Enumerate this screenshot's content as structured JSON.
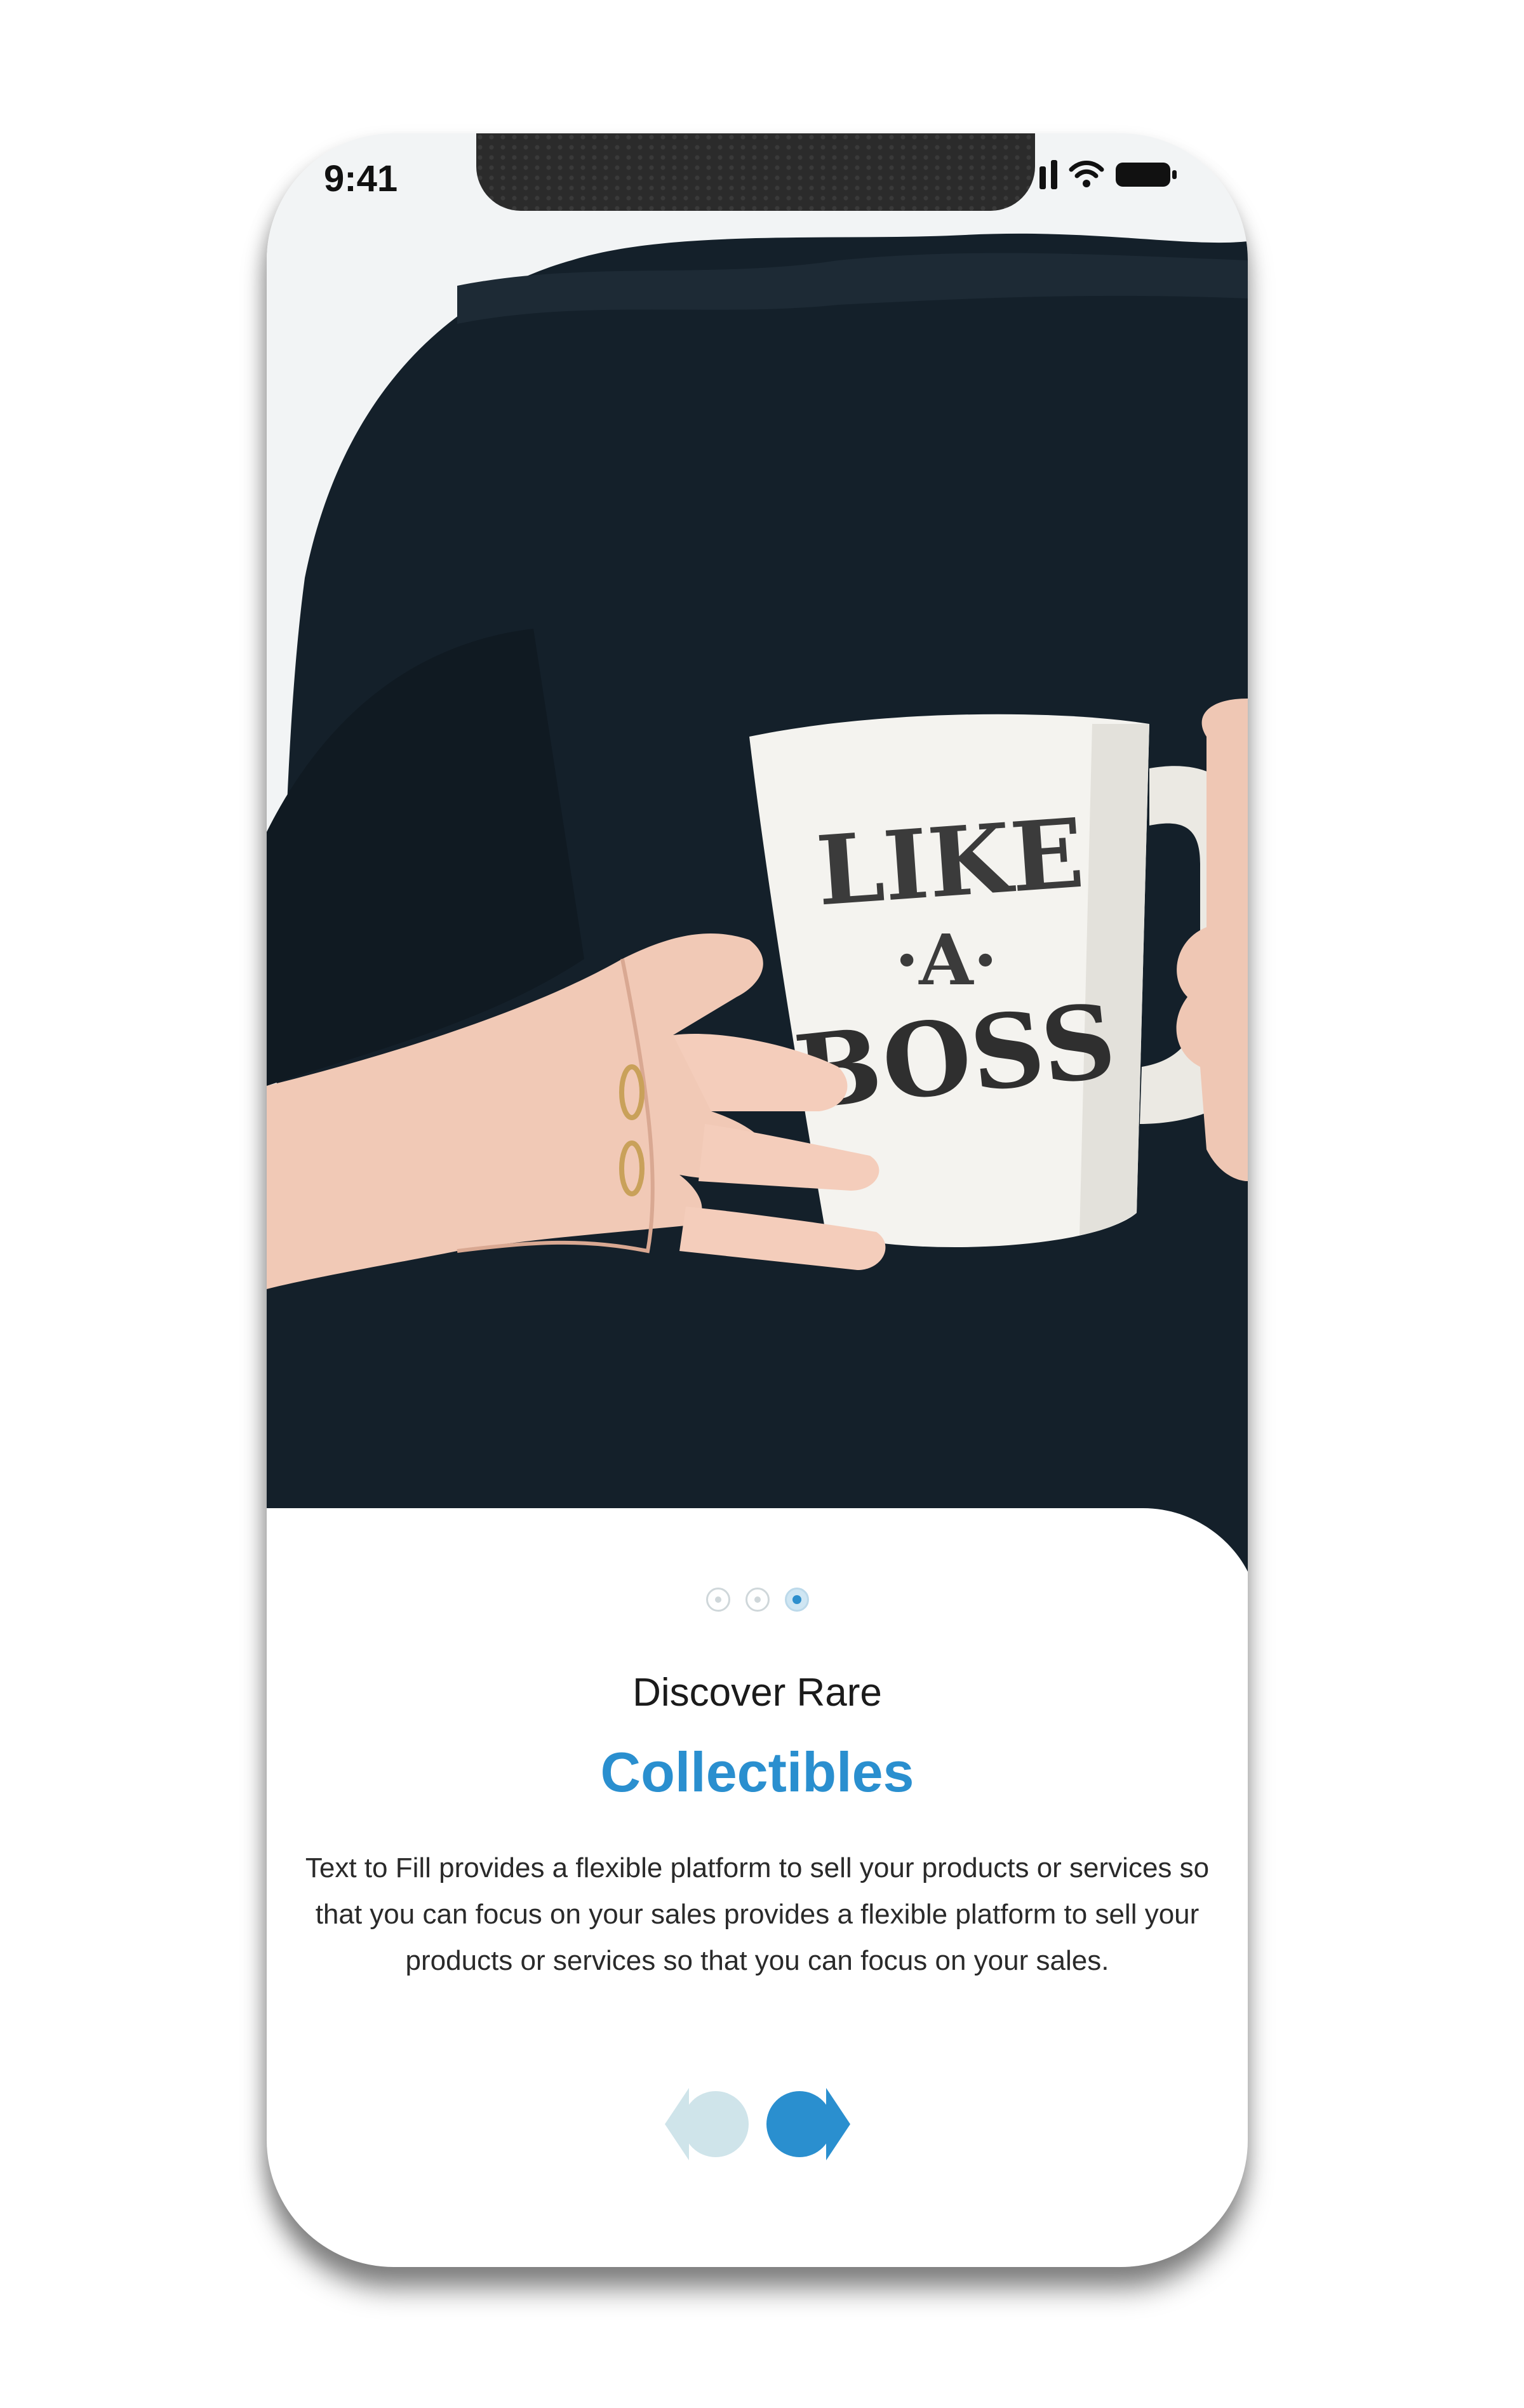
{
  "status_bar": {
    "time": "9:41"
  },
  "hero": {
    "mug_text_line1": "LIKE",
    "mug_text_line2": "·A·",
    "mug_text_line3": "BOSS"
  },
  "pagination": {
    "total": 3,
    "active_index": 2
  },
  "content": {
    "subtitle": "Discover Rare",
    "title": "Collectibles",
    "description": "Text to Fill provides a flexible platform to sell your products or services so that you can focus on your sales provides a flexible platform to sell your products or services so that you can focus on your sales."
  },
  "navigation": {
    "prev_icon": "chevron-left-icon",
    "next_icon": "chevron-right-icon"
  },
  "colors": {
    "accent": "#2a8fcf",
    "prev_button": "#cfe4ea",
    "next_button": "#2a8fcf",
    "shirt": "#14202a"
  }
}
